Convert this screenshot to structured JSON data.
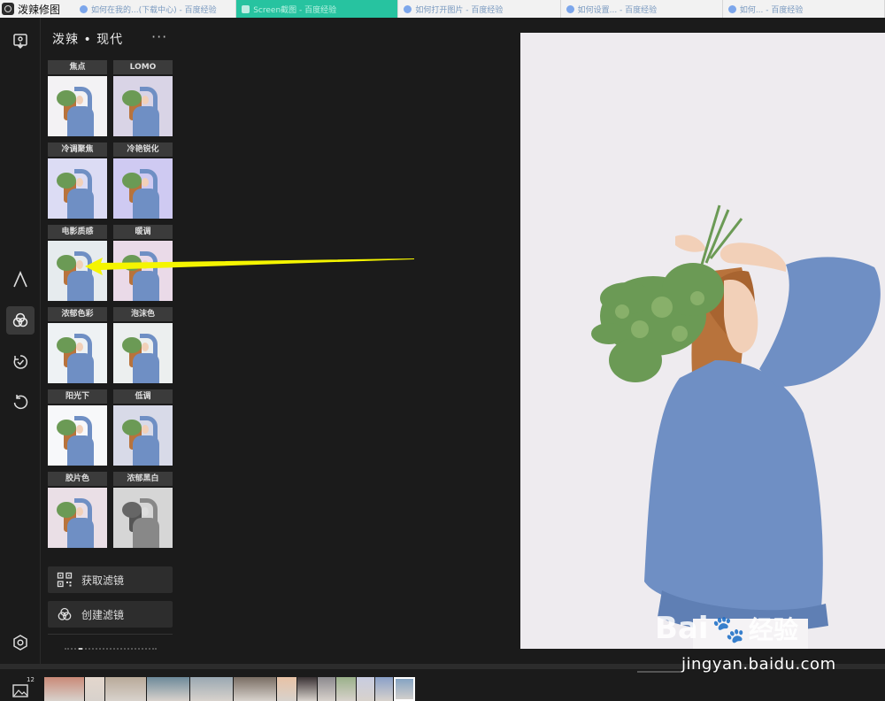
{
  "window": {
    "title": "泼辣修图"
  },
  "browser_tabs": [
    {
      "label": "如何在我的...(下载中心) - 百度经验",
      "active": false
    },
    {
      "label": "Screen截图 - 百度经验",
      "active": true
    },
    {
      "label": "如何打开图片 - 百度经验",
      "active": false
    },
    {
      "label": "如何设置... - 百度经验",
      "active": false
    },
    {
      "label": "如何... - 百度经验",
      "active": false
    }
  ],
  "sidebar": {
    "items": [
      {
        "name": "import",
        "icon": "import-photo-icon"
      },
      {
        "name": "text",
        "icon": "text-a-icon"
      },
      {
        "name": "filters",
        "icon": "filter-circles-icon",
        "active": true
      },
      {
        "name": "presets",
        "icon": "timer-check-icon"
      },
      {
        "name": "history",
        "icon": "undo-icon"
      },
      {
        "name": "settings",
        "icon": "hexagon-gear-icon"
      }
    ]
  },
  "panel": {
    "title": "泼辣 • 现代",
    "more": "···",
    "filters": [
      {
        "label": "焦点",
        "tint": "#f3f2f4"
      },
      {
        "label": "LOMO",
        "tint": "#d9d4e6"
      },
      {
        "label": "冷调聚焦",
        "tint": "#dcdcf4"
      },
      {
        "label": "冷艳锐化",
        "tint": "#cfcaf2"
      },
      {
        "label": "电影质感",
        "tint": "#e6ebee"
      },
      {
        "label": "暖调",
        "tint": "#eadae8"
      },
      {
        "label": "浓郁色彩",
        "tint": "#eef2f4"
      },
      {
        "label": "泡沫色",
        "tint": "#ecefef"
      },
      {
        "label": "阳光下",
        "tint": "#f7f8fa"
      },
      {
        "label": "低调",
        "tint": "#d8dae8"
      },
      {
        "label": "胶片色",
        "tint": "#eadfe6"
      },
      {
        "label": "浓郁黑白",
        "tint": "#d6d6d6"
      }
    ],
    "get_filters_label": "获取滤镜",
    "create_filter_label": "创建滤镜"
  },
  "bottom": {
    "album_count": "12"
  },
  "watermark": {
    "brand": "Bai",
    "brand_suffix": "经验",
    "url": "jingyan.baidu.com"
  },
  "colors": {
    "background": "#1b1b1b",
    "panel_button": "#2d2d2d",
    "active_tab": "#27c3a0",
    "arrow": "#f5f500",
    "sweater": "#6f8fc4"
  }
}
